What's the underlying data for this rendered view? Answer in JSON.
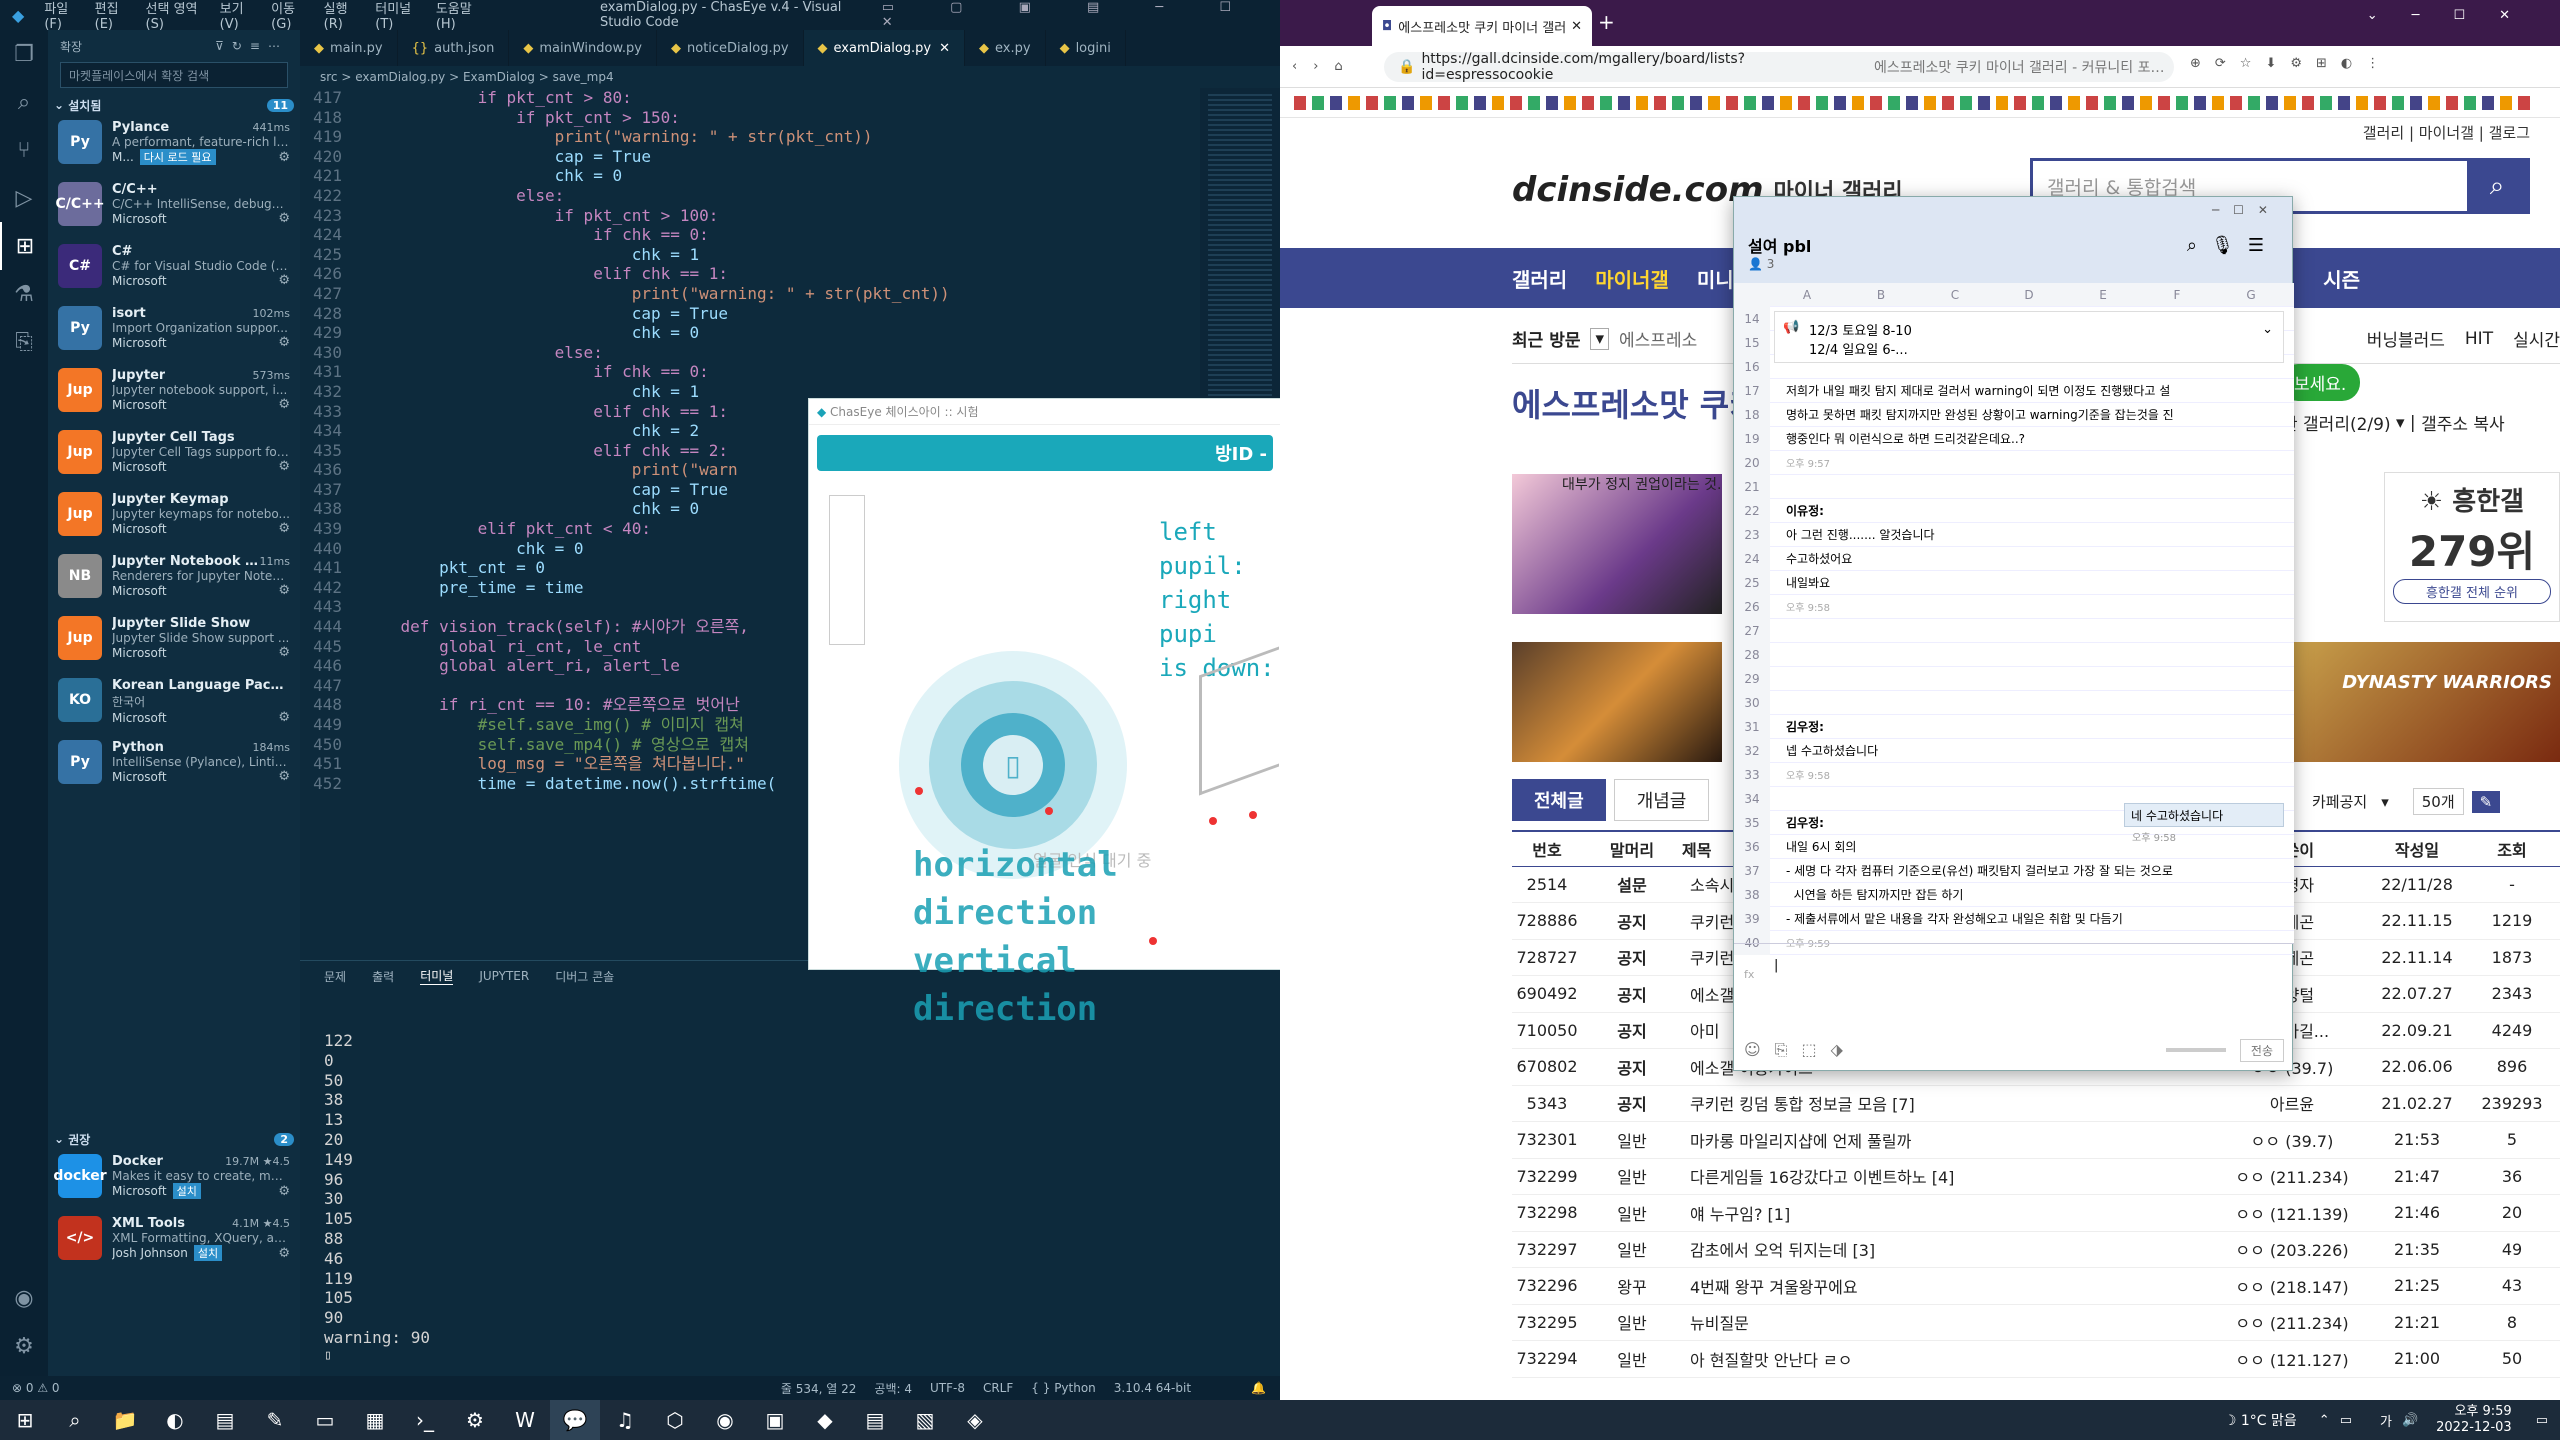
{
  "vscode": {
    "title": "examDialog.py - ChasEye v.4 - Visual Studio Code",
    "menu": [
      "파일(F)",
      "편집(E)",
      "선택 영역(S)",
      "보기(V)",
      "이동(G)",
      "실행(R)",
      "터미널(T)",
      "도움말(H)"
    ],
    "sidebar": {
      "header": "확장",
      "search_placeholder": "마켓플레이스에서 확장 검색",
      "installed_label": "설치됨",
      "installed_count": "11",
      "recommended_label": "권장",
      "recommended_count": "2",
      "extensions": [
        {
          "name": "Pylance",
          "desc": "A performant, feature-rich la...",
          "publisher": "M...",
          "meta": "441ms",
          "extra": "다시 로드 필요",
          "color": "#3572a5",
          "abbr": "Py"
        },
        {
          "name": "C/C++",
          "desc": "C/C++ IntelliSense, debuggi...",
          "publisher": "Microsoft",
          "meta": "",
          "extra": "",
          "color": "#6c6c9c",
          "abbr": "C/C++"
        },
        {
          "name": "C#",
          "desc": "C# for Visual Studio Code (p...",
          "publisher": "Microsoft",
          "meta": "",
          "extra": "",
          "color": "#3b2a7a",
          "abbr": "C#"
        },
        {
          "name": "isort",
          "desc": "Import Organization suppor...",
          "publisher": "Microsoft",
          "meta": "102ms",
          "extra": "",
          "color": "#3572a5",
          "abbr": "Py"
        },
        {
          "name": "Jupyter",
          "desc": "Jupyter notebook support, i...",
          "publisher": "Microsoft",
          "meta": "573ms",
          "extra": "",
          "color": "#f37626",
          "abbr": "Jup"
        },
        {
          "name": "Jupyter Cell Tags",
          "desc": "Jupyter Cell Tags support for...",
          "publisher": "Microsoft",
          "meta": "",
          "extra": "",
          "color": "#f37626",
          "abbr": "Jup"
        },
        {
          "name": "Jupyter Keymap",
          "desc": "Jupyter keymaps for notebo...",
          "publisher": "Microsoft",
          "meta": "",
          "extra": "",
          "color": "#f37626",
          "abbr": "Jup"
        },
        {
          "name": "Jupyter Notebook ...",
          "desc": "Renderers for Jupyter Noteb...",
          "publisher": "Microsoft",
          "meta": "11ms",
          "extra": "",
          "color": "#8a8a8a",
          "abbr": "NB"
        },
        {
          "name": "Jupyter Slide Show",
          "desc": "Jupyter Slide Show support ...",
          "publisher": "Microsoft",
          "meta": "",
          "extra": "",
          "color": "#f37626",
          "abbr": "Jup"
        },
        {
          "name": "Korean Language Pack for...",
          "desc": "한국어",
          "publisher": "Microsoft",
          "meta": "",
          "extra": "",
          "color": "#2a6f97",
          "abbr": "KO"
        },
        {
          "name": "Python",
          "desc": "IntelliSense (Pylance), Lintin...",
          "publisher": "Microsoft",
          "meta": "184ms",
          "extra": "",
          "color": "#3572a5",
          "abbr": "Py"
        }
      ],
      "recommended": [
        {
          "name": "Docker",
          "desc": "Makes it easy to create, man...",
          "publisher": "Microsoft",
          "meta": "19.7M ★4.5",
          "extra": "설치",
          "color": "#1d91e6",
          "abbr": "docker"
        },
        {
          "name": "XML Tools",
          "desc": "XML Formatting, XQuery, an...",
          "publisher": "Josh Johnson",
          "meta": "4.1M ★4.5",
          "extra": "설치",
          "color": "#c2321e",
          "abbr": "</>"
        }
      ]
    },
    "tabs": [
      "main.py",
      "auth.json",
      "mainWindow.py",
      "noticeDialog.py",
      "examDialog.py",
      "ex.py",
      "logini"
    ],
    "active_tab": "examDialog.py",
    "breadcrumb": "src > examDialog.py > ExamDialog > save_mp4",
    "code_lines": [
      {
        "n": "417",
        "t": "            if pkt_cnt > 80:"
      },
      {
        "n": "418",
        "t": "                if pkt_cnt > 150:"
      },
      {
        "n": "419",
        "t": "                    print(\"warning: \" + str(pkt_cnt))"
      },
      {
        "n": "420",
        "t": "                    cap = True"
      },
      {
        "n": "421",
        "t": "                    chk = 0"
      },
      {
        "n": "422",
        "t": "                else:"
      },
      {
        "n": "423",
        "t": "                    if pkt_cnt > 100:"
      },
      {
        "n": "424",
        "t": "                        if chk == 0:"
      },
      {
        "n": "425",
        "t": "                            chk = 1"
      },
      {
        "n": "426",
        "t": "                        elif chk == 1:"
      },
      {
        "n": "427",
        "t": "                            print(\"warning: \" + str(pkt_cnt))"
      },
      {
        "n": "428",
        "t": "                            cap = True"
      },
      {
        "n": "429",
        "t": "                            chk = 0"
      },
      {
        "n": "430",
        "t": "                    else:"
      },
      {
        "n": "431",
        "t": "                        if chk == 0:"
      },
      {
        "n": "432",
        "t": "                            chk = 1"
      },
      {
        "n": "433",
        "t": "                        elif chk == 1:"
      },
      {
        "n": "434",
        "t": "                            chk = 2"
      },
      {
        "n": "435",
        "t": "                        elif chk == 2:"
      },
      {
        "n": "436",
        "t": "                            print(\"warn"
      },
      {
        "n": "437",
        "t": "                            cap = True"
      },
      {
        "n": "438",
        "t": "                            chk = 0"
      },
      {
        "n": "439",
        "t": "            elif pkt_cnt < 40:"
      },
      {
        "n": "440",
        "t": "                chk = 0"
      },
      {
        "n": "441",
        "t": "        pkt_cnt = 0"
      },
      {
        "n": "442",
        "t": "        pre_time = time"
      },
      {
        "n": "443",
        "t": ""
      },
      {
        "n": "444",
        "t": "    def vision_track(self): #시야가 오른쪽,"
      },
      {
        "n": "445",
        "t": "        global ri_cnt, le_cnt"
      },
      {
        "n": "446",
        "t": "        global alert_ri, alert_le"
      },
      {
        "n": "447",
        "t": ""
      },
      {
        "n": "448",
        "t": "        if ri_cnt == 10: #오른쪽으로 벗어난"
      },
      {
        "n": "449",
        "t": "            #self.save_img() # 이미지 캡쳐"
      },
      {
        "n": "450",
        "t": "            self.save_mp4() # 영상으로 캡쳐"
      },
      {
        "n": "451",
        "t": "            log_msg = \"오른쪽을 쳐다봅니다.\""
      },
      {
        "n": "452",
        "t": "            time = datetime.now().strftime("
      }
    ],
    "panel_tabs": [
      "문제",
      "출력",
      "터미널",
      "JUPYTER",
      "디버그 콘솔"
    ],
    "terminal_lines": [
      "122",
      "0",
      "50",
      "38",
      "13",
      "20",
      "149",
      "96",
      "30",
      "105",
      "88",
      "46",
      "119",
      "105",
      "90",
      "warning: 90"
    ],
    "status": {
      "errors": "0",
      "warnings": "0",
      "position": "줄 534, 열 22",
      "spaces": "공백: 4",
      "encoding": "UTF-8",
      "eol": "CRLF",
      "language": "Python",
      "version": "3.10.4 64-bit"
    }
  },
  "popup": {
    "title": "ChasEye 체이스아이 :: 시험",
    "banner": "방ID -",
    "side_text": [
      "left pupil:",
      "right pupi",
      "is down:"
    ],
    "horizontal": "horizontal direction",
    "vertical": "vertical direction",
    "behind_text": "얼굴 인식 대기 중"
  },
  "browser": {
    "tab_title": "에스프레소맛 쿠키 마이너 갤러",
    "url": "https://gall.dcinside.com/mgallery/board/lists?id=espressocookie",
    "url_title": "에스프레소맛 쿠키 마이너 갤러리 - 커뮤니티 포털 디시인사",
    "top_links": [
      "갤러리",
      "마이너갤",
      "갤로그"
    ],
    "logo": "dcinside.com",
    "logo_sub": "마이너 갤러리",
    "search_placeholder": "갤러리 & 통합검색",
    "nav": [
      "갤러리",
      "마이너갤",
      "미니"
    ],
    "nav_right": "시즌",
    "recent": "최근 방문",
    "recent_item": "에스프레소",
    "recent_right": [
      "버닝블러드",
      "HIT",
      "실시간"
    ],
    "gallery_title": "에스프레소맛 쿠키",
    "gallery_button": "보세요.",
    "gallery_links": [
      "관 갤러리(2/9)",
      "갤주소 복사"
    ],
    "rank_label": "흥한갤",
    "rank_value": "279위",
    "rank_link": "흥한갤 전체 순위",
    "banner_caption": "대부가 정지 권업이라는 것.",
    "promo": "DYNASTY WARRIORS",
    "tabs": [
      "전체글",
      "개념글"
    ],
    "notice_select": "카페공지",
    "per_page": "50개",
    "table_headers": [
      "번호",
      "말머리",
      "제목",
      "글쓴이",
      "작성일",
      "조회"
    ],
    "rows": [
      {
        "no": "2514",
        "head": "설문",
        "title": "소속시",
        "writer": "운영자",
        "date": "22/11/28",
        "views": "-"
      },
      {
        "no": "728886",
        "head": "공지",
        "title": "쿠키런",
        "writer": "드레곤",
        "date": "22.11.15",
        "views": "1219"
      },
      {
        "no": "728727",
        "head": "공지",
        "title": "쿠키런",
        "writer": "드레곤",
        "date": "22.11.14",
        "views": "1873"
      },
      {
        "no": "690492",
        "head": "공지",
        "title": "에소갤",
        "writer": "항양털",
        "date": "22.07.27",
        "views": "2343"
      },
      {
        "no": "710050",
        "head": "공지",
        "title": "아미",
        "writer": "에호가길...",
        "date": "22.09.21",
        "views": "4249"
      },
      {
        "no": "670802",
        "head": "공지",
        "title": "에소갤 이용가이드",
        "writer": "ㅇㅇ (39.7)",
        "date": "22.06.06",
        "views": "896"
      },
      {
        "no": "5343",
        "head": "공지",
        "title": "쿠키런 킹덤 통합 정보글 모음 [7]",
        "writer": "아르윤",
        "date": "21.02.27",
        "views": "239293"
      },
      {
        "no": "732301",
        "head": "일반",
        "title": "마카롱 마일리지샵에 언제 풀릴까",
        "writer": "ㅇㅇ (39.7)",
        "date": "21:53",
        "views": "5"
      },
      {
        "no": "732299",
        "head": "일반",
        "title": "다른게임들 16강갔다고 이벤트하노 [4]",
        "writer": "ㅇㅇ (211.234)",
        "date": "21:47",
        "views": "36"
      },
      {
        "no": "732298",
        "head": "일반",
        "title": "얘 누구임? [1]",
        "writer": "ㅇㅇ (121.139)",
        "date": "21:46",
        "views": "20"
      },
      {
        "no": "732297",
        "head": "일반",
        "title": "감초에서 오억 뒤지는데 [3]",
        "writer": "ㅇㅇ (203.226)",
        "date": "21:35",
        "views": "49"
      },
      {
        "no": "732296",
        "head": "왕꾸",
        "title": "4번째 왕꾸 겨울왕꾸에요",
        "writer": "ㅇㅇ (218.147)",
        "date": "21:25",
        "views": "43"
      },
      {
        "no": "732295",
        "head": "일반",
        "title": "뉴비질문",
        "writer": "ㅇㅇ (211.234)",
        "date": "21:21",
        "views": "8"
      },
      {
        "no": "732294",
        "head": "일반",
        "title": "아 현질할맛 안난다 ㄹㅇ",
        "writer": "ㅇㅇ (121.127)",
        "date": "21:00",
        "views": "50"
      }
    ]
  },
  "chat": {
    "room": "설여 pbl",
    "members": "3",
    "notice_line1": "12/3 토요일 8-10",
    "notice_line2": "12/4 일요일 6-...",
    "columns": [
      "A",
      "B",
      "C",
      "D",
      "E",
      "F",
      "G"
    ],
    "rows": [
      {
        "n": "14",
        "text": "",
        "sub": ""
      },
      {
        "n": "15",
        "text": "",
        "sub": ""
      },
      {
        "n": "16",
        "text": "",
        "sub": ""
      },
      {
        "n": "17",
        "text": "저희가 내일 패킷 탐지 제대로 걸러서 warning이 되면 이정도 진행됐다고 설",
        "sub": ""
      },
      {
        "n": "18",
        "text": "명하고 못하면 패킷 탐지까지만 완성된 상황이고 warning기준을 잡는것을 진",
        "sub": ""
      },
      {
        "n": "19",
        "text": "행중인다 뭐 이런식으로 하면 드리것같은데요..?",
        "sub": ""
      },
      {
        "n": "20",
        "text": "",
        "sub": "오후 9:57"
      },
      {
        "n": "21",
        "text": "",
        "sub": ""
      },
      {
        "n": "22",
        "text": "이유정:",
        "sub": ""
      },
      {
        "n": "23",
        "text": "아 그런 진행....... 알것습니다",
        "sub": ""
      },
      {
        "n": "24",
        "text": "수고하셨어요",
        "sub": ""
      },
      {
        "n": "25",
        "text": "내일봐요",
        "sub": ""
      },
      {
        "n": "26",
        "text": "",
        "sub": "오후 9:58"
      },
      {
        "n": "27",
        "text": "",
        "sub": ""
      },
      {
        "n": "28",
        "text": "",
        "sub": ""
      },
      {
        "n": "29",
        "text": "",
        "sub": ""
      },
      {
        "n": "30",
        "text": "",
        "sub": ""
      },
      {
        "n": "31",
        "text": "김우정:",
        "sub": ""
      },
      {
        "n": "32",
        "text": "넵 수고하셨습니다",
        "sub": ""
      },
      {
        "n": "33",
        "text": "",
        "sub": "오후 9:58"
      },
      {
        "n": "34",
        "text": "",
        "sub": ""
      },
      {
        "n": "35",
        "text": "김우정:",
        "sub": ""
      },
      {
        "n": "36",
        "text": "내일 6시 회의",
        "sub": ""
      },
      {
        "n": "37",
        "text": "- 세명 다 각자 컴퓨터 기준으로(유선) 패킷탐지 걸러보고 가장 잘 되는 것으로",
        "sub": ""
      },
      {
        "n": "38",
        "text": "  시연을 하든 탐지까지만 잡든 하기",
        "sub": ""
      },
      {
        "n": "39",
        "text": "- 제출서류에서 맡은 내용을 각자 완성해오고 내일은 취합 및 다듬기",
        "sub": ""
      },
      {
        "n": "40",
        "text": "",
        "sub": "오후 9:59"
      }
    ],
    "my_message": "네 수고하셨습니다",
    "my_time": "오후 9:58",
    "send_label": "전송"
  },
  "taskbar": {
    "weather": "1°C 맑음",
    "lang": "가",
    "time": "오후 9:59",
    "date": "2022-12-03"
  }
}
